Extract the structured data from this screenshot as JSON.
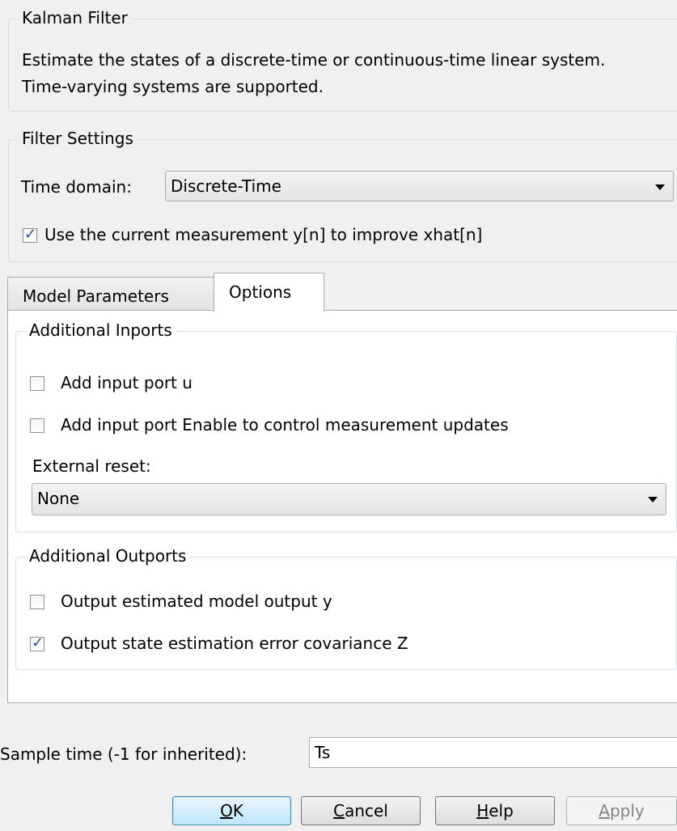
{
  "kalman_group": {
    "title": "Kalman Filter",
    "description": "Estimate the states of a discrete-time or continuous-time linear system. Time-varying systems are supported."
  },
  "filter_settings": {
    "title": "Filter Settings",
    "time_domain_label": "Time domain:",
    "time_domain_value": "Discrete-Time",
    "use_current_measurement_label": "Use the current measurement y[n] to improve xhat[n]",
    "use_current_measurement_checked": true
  },
  "tabs": [
    {
      "label": "Model Parameters",
      "active": false
    },
    {
      "label": "Options",
      "active": true
    }
  ],
  "additional_inports": {
    "title": "Additional Inports",
    "add_input_port_u_label": "Add input port u",
    "add_input_port_u_checked": false,
    "add_enable_port_label": "Add input port Enable to control measurement updates",
    "add_enable_port_checked": false,
    "external_reset_label": "External reset:",
    "external_reset_value": "None"
  },
  "additional_outports": {
    "title": "Additional Outports",
    "output_model_output_label": "Output estimated model output y",
    "output_model_output_checked": false,
    "output_covariance_label": "Output state estimation error covariance Z",
    "output_covariance_checked": true
  },
  "sample_time": {
    "label": "Sample time (-1 for inherited):",
    "value": "Ts"
  },
  "buttons": {
    "ok": {
      "mnemonic": "O",
      "rest": "K"
    },
    "cancel": {
      "mnemonic": "C",
      "rest": "ancel"
    },
    "help": {
      "mnemonic": "H",
      "rest": "elp"
    },
    "apply": {
      "mnemonic": "A",
      "rest": "pply"
    }
  },
  "colors": {
    "background": "#f0f0f0",
    "check_accent": "#2a4f8a",
    "default_button": "#bee6fd"
  }
}
